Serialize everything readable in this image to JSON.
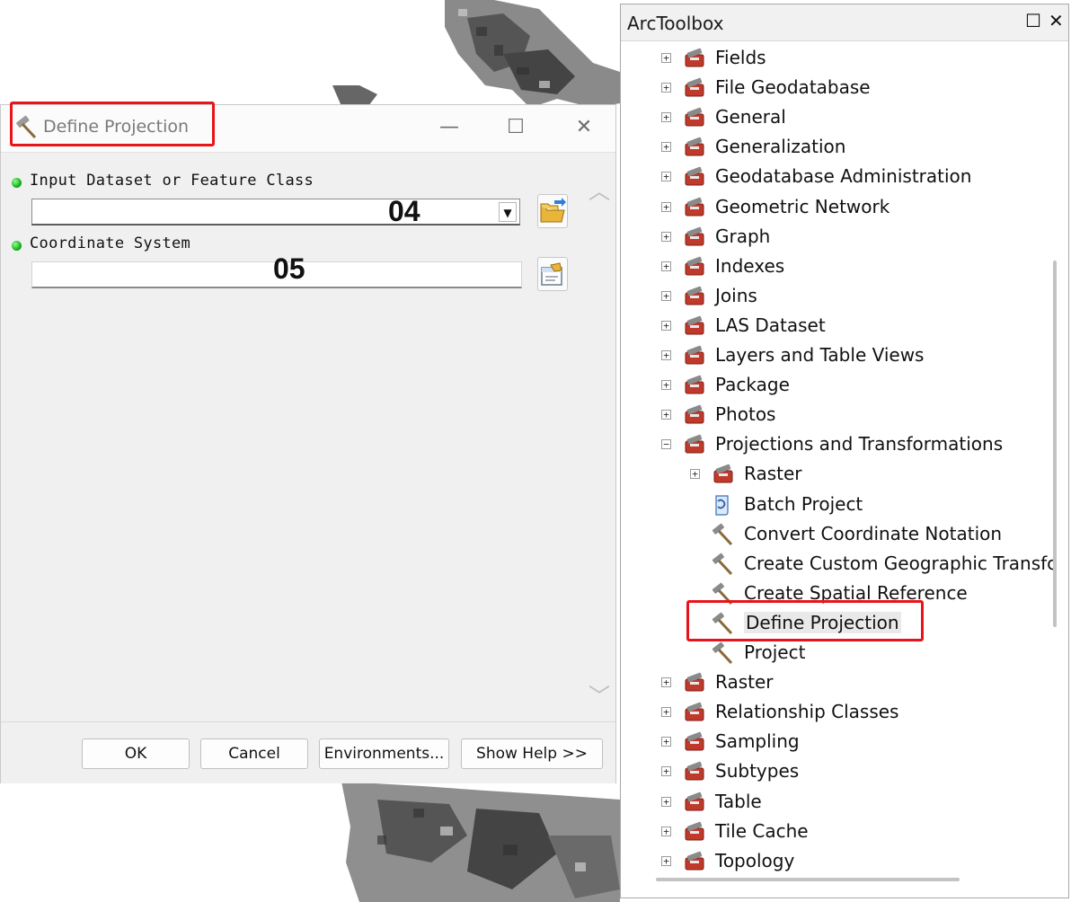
{
  "dialog": {
    "title": "Define Projection",
    "params": [
      {
        "label": "Input Dataset or Feature Class",
        "value": ""
      },
      {
        "label": "Coordinate System",
        "value": ""
      }
    ],
    "overlay_numbers": [
      "04",
      "05"
    ],
    "buttons": {
      "ok": "OK",
      "cancel": "Cancel",
      "environments": "Environments...",
      "show_help": "Show Help >>"
    }
  },
  "toolbox": {
    "title": "ArcToolbox",
    "items": [
      {
        "label": "Fields",
        "kind": "toolset",
        "expand": "+"
      },
      {
        "label": "File Geodatabase",
        "kind": "toolset",
        "expand": "+"
      },
      {
        "label": "General",
        "kind": "toolset",
        "expand": "+"
      },
      {
        "label": "Generalization",
        "kind": "toolset",
        "expand": "+"
      },
      {
        "label": "Geodatabase Administration",
        "kind": "toolset",
        "expand": "+"
      },
      {
        "label": "Geometric Network",
        "kind": "toolset",
        "expand": "+"
      },
      {
        "label": "Graph",
        "kind": "toolset",
        "expand": "+"
      },
      {
        "label": "Indexes",
        "kind": "toolset",
        "expand": "+"
      },
      {
        "label": "Joins",
        "kind": "toolset",
        "expand": "+"
      },
      {
        "label": "LAS Dataset",
        "kind": "toolset",
        "expand": "+"
      },
      {
        "label": "Layers and Table Views",
        "kind": "toolset",
        "expand": "+"
      },
      {
        "label": "Package",
        "kind": "toolset",
        "expand": "+"
      },
      {
        "label": "Photos",
        "kind": "toolset",
        "expand": "+"
      },
      {
        "label": "Projections and Transformations",
        "kind": "toolset",
        "expand": "−"
      },
      {
        "label": "Raster",
        "kind": "toolset",
        "expand": "+",
        "level": 2
      },
      {
        "label": "Batch Project",
        "kind": "script",
        "level": 2
      },
      {
        "label": "Convert Coordinate Notation",
        "kind": "tool",
        "level": 2
      },
      {
        "label": "Create Custom Geographic Transfc",
        "kind": "tool",
        "level": 2
      },
      {
        "label": "Create Spatial Reference",
        "kind": "tool",
        "level": 2
      },
      {
        "label": "Define Projection",
        "kind": "tool",
        "level": 2,
        "selected": true
      },
      {
        "label": "Project",
        "kind": "tool",
        "level": 2
      },
      {
        "label": "Raster",
        "kind": "toolset",
        "expand": "+"
      },
      {
        "label": "Relationship Classes",
        "kind": "toolset",
        "expand": "+"
      },
      {
        "label": "Sampling",
        "kind": "toolset",
        "expand": "+"
      },
      {
        "label": "Subtypes",
        "kind": "toolset",
        "expand": "+"
      },
      {
        "label": "Table",
        "kind": "toolset",
        "expand": "+"
      },
      {
        "label": "Tile Cache",
        "kind": "toolset",
        "expand": "+"
      },
      {
        "label": "Topology",
        "kind": "toolset",
        "expand": "+"
      }
    ]
  },
  "colors": {
    "highlight": "#e8141a",
    "required_dot": "#0aa10a"
  }
}
